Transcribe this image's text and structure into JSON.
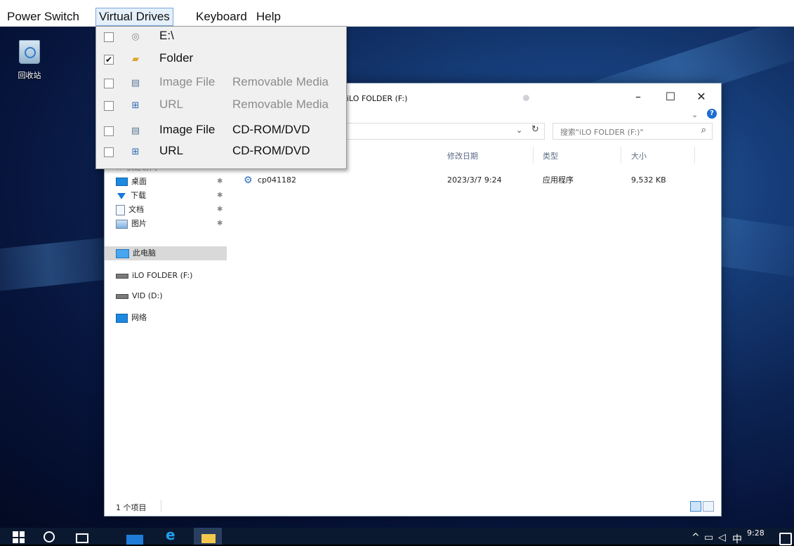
{
  "menubar": {
    "items": [
      "Power Switch",
      "Virtual Drives",
      "Keyboard",
      "Help"
    ],
    "open_index": 1
  },
  "virtual_drives_menu": {
    "items": [
      {
        "checked": false,
        "icon": "cd-drive-icon",
        "label": "E:\\",
        "sub": "",
        "enabled": true
      },
      {
        "checked": true,
        "icon": "folder-icon",
        "label": "Folder",
        "sub": "",
        "enabled": true
      },
      {
        "checked": false,
        "icon": "image-file-icon",
        "label": "Image File",
        "sub": "Removable Media",
        "enabled": false
      },
      {
        "checked": false,
        "icon": "network-url-icon",
        "label": "URL",
        "sub": "Removable Media",
        "enabled": false
      },
      {
        "checked": false,
        "icon": "image-file-icon",
        "label": "Image File",
        "sub": "CD-ROM/DVD",
        "enabled": true
      },
      {
        "checked": false,
        "icon": "network-url-icon",
        "label": "URL",
        "sub": "CD-ROM/DVD",
        "enabled": true
      }
    ],
    "check_mark": "✔"
  },
  "desktop": {
    "recycle_bin_label": "回收站"
  },
  "explorer": {
    "title": "iLO FOLDER (F:)",
    "minimize": "–",
    "maximize": "☐",
    "close": "✕",
    "ribbon_chevron": "⌄",
    "help": "?",
    "search_placeholder": "搜索\"iLO FOLDER (F:)\"",
    "columns": {
      "date": "修改日期",
      "type": "类型",
      "size": "大小"
    },
    "nav": {
      "quick_access": "快速访问",
      "desktop": "桌面",
      "downloads": "下载",
      "documents": "文档",
      "pictures": "图片",
      "this_pc": "此电脑",
      "ilo_folder": "iLO FOLDER (F:)",
      "vid": "VID (D:)",
      "network": "网络"
    },
    "files": [
      {
        "name": "cp041182",
        "date": "2023/3/7 9:24",
        "type": "应用程序",
        "size": "9,532 KB"
      }
    ],
    "status": "1 个项目"
  },
  "taskbar": {
    "clock": "9:28",
    "ime": "中"
  }
}
